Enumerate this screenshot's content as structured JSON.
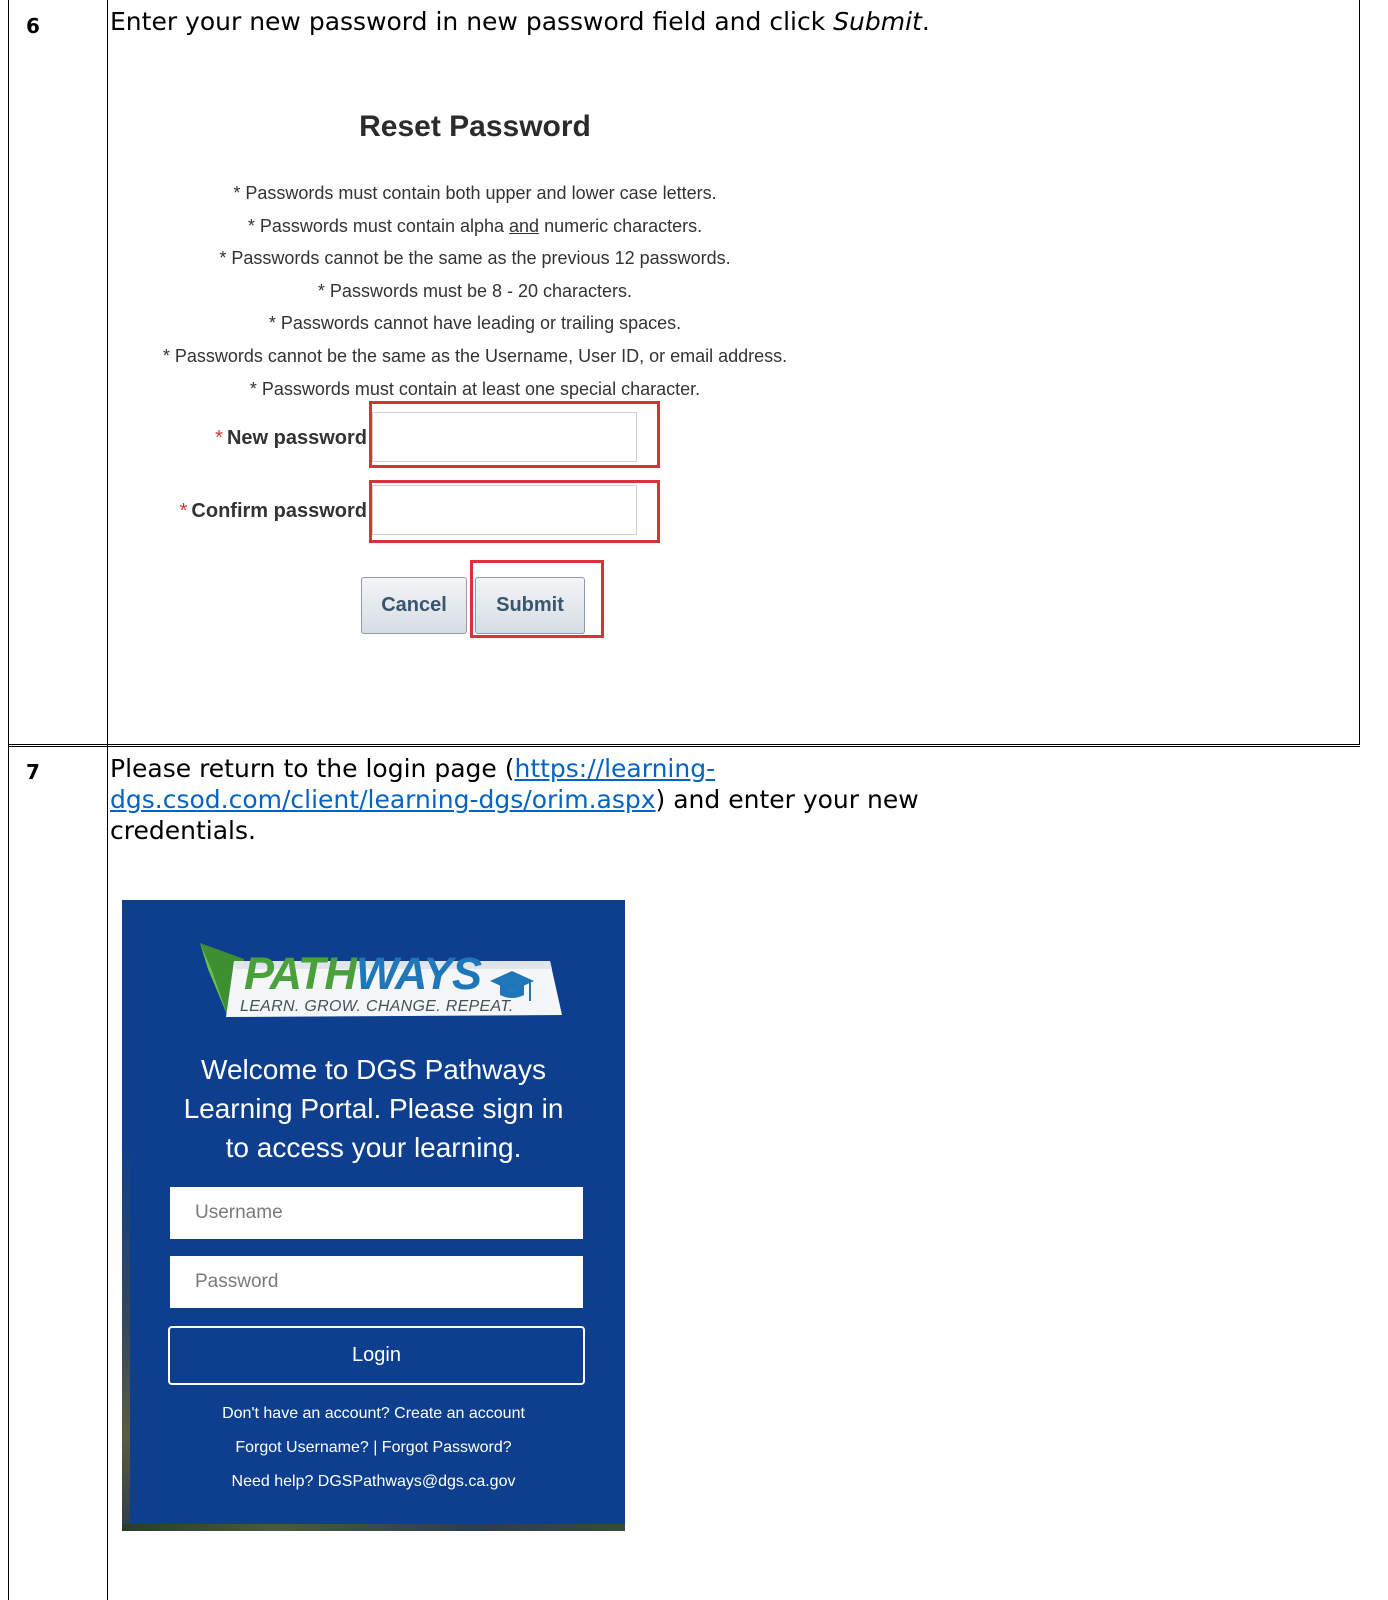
{
  "step6": {
    "number": "6",
    "instruction_prefix": "Enter your new password in new password field and click ",
    "instruction_emphasis": "Submit",
    "instruction_suffix": ".",
    "screen": {
      "title": "Reset Password",
      "rules": [
        "* Passwords must contain both upper and lower case letters.",
        "* Passwords cannot be the same as the previous 12 passwords.",
        "* Passwords must be 8 - 20 characters.",
        "* Passwords cannot have leading or trailing spaces.",
        "* Passwords cannot be the same as the Username, User ID, or email address.",
        "* Passwords must contain at least one special character."
      ],
      "rule2_before": "* Passwords must contain alpha ",
      "rule2_underlined": "and",
      "rule2_after": " numeric characters.",
      "required_mark": "*",
      "new_password_label": "New password",
      "new_password_value": "",
      "confirm_password_label": "Confirm password",
      "confirm_password_value": "",
      "cancel_label": "Cancel",
      "submit_label": "Submit",
      "highlight_color": "#d8333b"
    }
  },
  "step7": {
    "number": "7",
    "instruction_prefix": "Please return to the login page (",
    "link_line1": "https://learning-",
    "link_line2": "dgs.csod.com/client/learning-dgs/orim.aspx",
    "instruction_suffix": ") and enter your new",
    "instruction_line3": "credentials.",
    "link_color": "#0563c1",
    "login": {
      "logo_word_part1": "PATH",
      "logo_word_part2": "WAYS",
      "logo_tagline": "LEARN. GROW. CHANGE. REPEAT.",
      "welcome_lines": [
        "Welcome to DGS Pathways",
        "Learning Portal. Please sign in",
        "to access your learning."
      ],
      "username_placeholder": "Username",
      "username_value": "",
      "password_placeholder": "Password",
      "password_value": "",
      "login_label": "Login",
      "no_account_text": "Don't have an account? Create an account",
      "forgot_username": "Forgot Username?",
      "separator": "|",
      "forgot_password": "Forgot Password?",
      "help_text": "Need help? DGSPathways@dgs.ca.gov",
      "background_color": "#0d3f8e"
    }
  }
}
